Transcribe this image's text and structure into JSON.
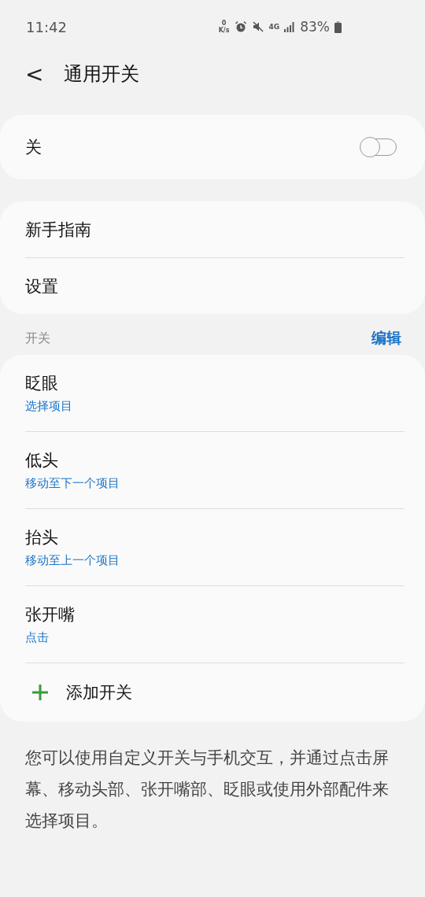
{
  "status_bar": {
    "time": "11:42",
    "net_speed_value": "0",
    "net_speed_unit": "K/s",
    "network": "4G",
    "battery": "83%"
  },
  "header": {
    "back_icon": "<",
    "title": "通用开关"
  },
  "master": {
    "label": "关",
    "on": false
  },
  "menu": [
    {
      "label": "新手指南"
    },
    {
      "label": "设置"
    }
  ],
  "switches_section": {
    "title": "开关",
    "edit": "编辑"
  },
  "switches": [
    {
      "name": "眨眼",
      "action": "选择项目"
    },
    {
      "name": "低头",
      "action": "移动至下一个项目"
    },
    {
      "name": "抬头",
      "action": "移动至上一个项目"
    },
    {
      "name": "张开嘴",
      "action": "点击"
    }
  ],
  "add_switch": {
    "label": "添加开关"
  },
  "description": "您可以使用自定义开关与手机交互，并通过点击屏幕、移动头部、张开嘴部、眨眼或使用外部配件来选择项目。"
}
